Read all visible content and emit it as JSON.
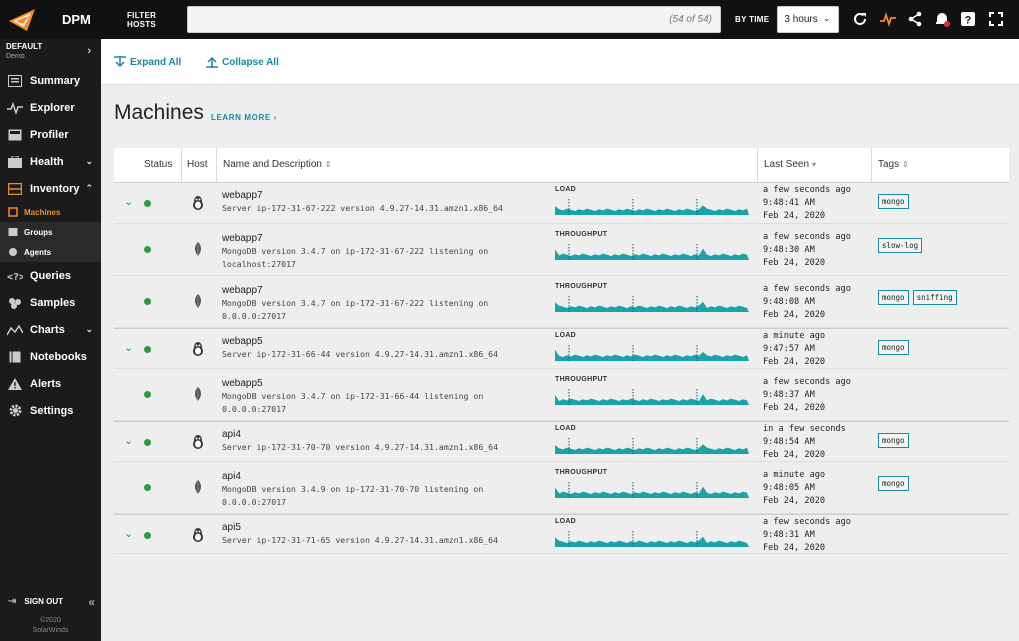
{
  "app": {
    "name": "DPM"
  },
  "topbar": {
    "filter_label": "FILTER HOSTS",
    "filter_value": "",
    "filter_count": "(54 of 54)",
    "bytime_label": "BY TIME",
    "time_value": "3 hours",
    "icons": [
      "refresh-icon",
      "activity-icon",
      "share-icon",
      "notification-bell-icon",
      "help-icon",
      "fullscreen-icon"
    ]
  },
  "sidebar": {
    "org": {
      "name": "DEFAULT",
      "sub": "Demo"
    },
    "items": [
      {
        "label": "Summary",
        "icon": "summary-icon"
      },
      {
        "label": "Explorer",
        "icon": "explorer-icon"
      },
      {
        "label": "Profiler",
        "icon": "profiler-icon"
      },
      {
        "label": "Health",
        "icon": "health-icon"
      },
      {
        "label": "Inventory",
        "icon": "inventory-icon"
      },
      {
        "label": "Machines",
        "icon": "machines-icon"
      },
      {
        "label": "Groups",
        "icon": "groups-icon"
      },
      {
        "label": "Agents",
        "icon": "agents-icon"
      },
      {
        "label": "Queries",
        "icon": "queries-icon"
      },
      {
        "label": "Samples",
        "icon": "samples-icon"
      },
      {
        "label": "Charts",
        "icon": "charts-icon"
      },
      {
        "label": "Notebooks",
        "icon": "notebooks-icon"
      },
      {
        "label": "Alerts",
        "icon": "alerts-icon"
      },
      {
        "label": "Settings",
        "icon": "settings-icon"
      }
    ],
    "signout": "SIGN OUT",
    "copyright_line1": "©2020",
    "copyright_line2": "SolarWinds",
    "accent": "#f08b28"
  },
  "toolbar": {
    "expand_all": "Expand All",
    "collapse_all": "Collapse All"
  },
  "main": {
    "title": "Machines",
    "learn_more": "LEARN MORE ›"
  },
  "table": {
    "headers": {
      "status": "Status",
      "host": "Host",
      "name": "Name and Description",
      "last_seen": "Last Seen",
      "tags": "Tags"
    },
    "rows": [
      {
        "name": "webapp7",
        "desc1": "Server ip-172-31-67-222 version 4.9.27-14.31.amzn1.x86_64",
        "desc2": "",
        "metric": "LOAD",
        "seen1": "a few seconds ago",
        "seen2": "9:48:41 AM",
        "seen3": "Feb 24, 2020",
        "tags": [
          "mongo"
        ],
        "parent": true,
        "host": "linux-icon"
      },
      {
        "name": "webapp7",
        "desc1": "MongoDB version 3.4.7 on ip-172-31-67-222 listening on",
        "desc2": "localhost:27017",
        "metric": "THROUGHPUT",
        "seen1": "a few seconds ago",
        "seen2": "9:48:30 AM",
        "seen3": "Feb 24, 2020",
        "tags": [
          "slow-log"
        ],
        "parent": false,
        "host": "mongodb-icon"
      },
      {
        "name": "webapp7",
        "desc1": "MongoDB version 3.4.7 on ip-172-31-67-222 listening on",
        "desc2": "0.0.0.0:27017",
        "metric": "THROUGHPUT",
        "seen1": "a few seconds ago",
        "seen2": "9:48:08 AM",
        "seen3": "Feb 24, 2020",
        "tags": [
          "mongo",
          "sniffing"
        ],
        "parent": false,
        "host": "mongodb-icon"
      },
      {
        "name": "webapp5",
        "desc1": "Server ip-172-31-66-44 version 4.9.27-14.31.amzn1.x86_64",
        "desc2": "",
        "metric": "LOAD",
        "seen1": "a minute ago",
        "seen2": "9:47:57 AM",
        "seen3": "Feb 24, 2020",
        "tags": [
          "mongo"
        ],
        "parent": true,
        "host": "linux-icon"
      },
      {
        "name": "webapp5",
        "desc1": "MongoDB version 3.4.7 on ip-172-31-66-44 listening on",
        "desc2": "0.0.0.0:27017",
        "metric": "THROUGHPUT",
        "seen1": "a few seconds ago",
        "seen2": "9:48:37 AM",
        "seen3": "Feb 24, 2020",
        "tags": [],
        "parent": false,
        "host": "mongodb-icon"
      },
      {
        "name": "api4",
        "desc1": "Server ip-172-31-70-70 version 4.9.27-14.31.amzn1.x86_64",
        "desc2": "",
        "metric": "LOAD",
        "seen1": "in a few seconds",
        "seen2": "9:48:54 AM",
        "seen3": "Feb 24, 2020",
        "tags": [
          "mongo"
        ],
        "parent": true,
        "host": "linux-icon"
      },
      {
        "name": "api4",
        "desc1": "MongoDB version 3.4.9 on ip-172-31-70-70 listening on",
        "desc2": "0.0.0.0:27017",
        "metric": "THROUGHPUT",
        "seen1": "a minute ago",
        "seen2": "9:48:05 AM",
        "seen3": "Feb 24, 2020",
        "tags": [
          "mongo"
        ],
        "parent": false,
        "host": "mongodb-icon"
      },
      {
        "name": "api5",
        "desc1": "Server ip-172-31-71-65 version 4.9.27-14.31.amzn1.x86_64",
        "desc2": "",
        "metric": "LOAD",
        "seen1": "a few seconds ago",
        "seen2": "9:48:31 AM",
        "seen3": "Feb 24, 2020",
        "tags": [],
        "parent": true,
        "host": "linux-icon"
      }
    ]
  },
  "colors": {
    "teal": "#1a8a9f",
    "spark": "#1aa3a8",
    "status_ok": "#2e9a3a"
  }
}
